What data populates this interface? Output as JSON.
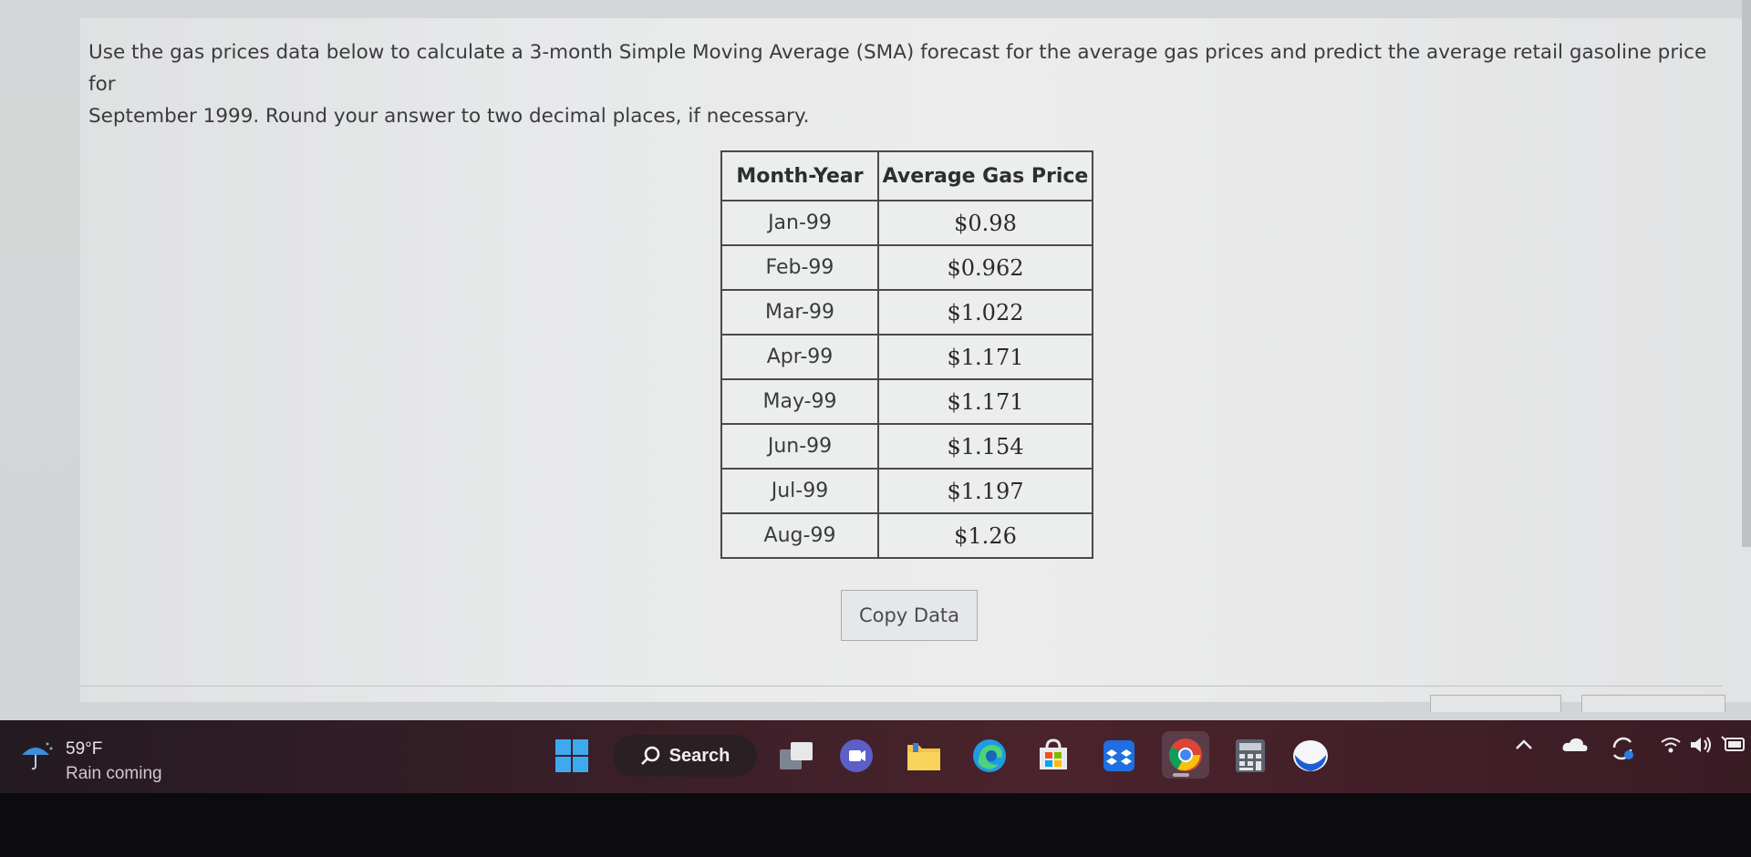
{
  "question": {
    "line1": "Use the gas prices data below to calculate a 3-month Simple Moving Average (SMA) forecast for the average gas prices and predict the average retail gasoline price for",
    "line2": "September 1999. Round your answer to two decimal places, if necessary."
  },
  "table": {
    "headers": [
      "Month-Year",
      "Average Gas Price"
    ],
    "rows": [
      {
        "month": "Jan-99",
        "price": "$0.98"
      },
      {
        "month": "Feb-99",
        "price": "$0.962"
      },
      {
        "month": "Mar-99",
        "price": "$1.022"
      },
      {
        "month": "Apr-99",
        "price": "$1.171"
      },
      {
        "month": "May-99",
        "price": "$1.171"
      },
      {
        "month": "Jun-99",
        "price": "$1.154"
      },
      {
        "month": "Jul-99",
        "price": "$1.197"
      },
      {
        "month": "Aug-99",
        "price": "$1.26"
      }
    ]
  },
  "copy_button": "Copy Data",
  "taskbar": {
    "weather_temp": "59°F",
    "weather_desc": "Rain coming",
    "search_label": "Search",
    "icons": [
      "windows-start-icon",
      "search-icon",
      "task-view-icon",
      "teams-chat-icon",
      "file-explorer-icon",
      "edge-icon",
      "microsoft-store-icon",
      "dropbox-icon",
      "chrome-icon",
      "calculator-icon",
      "blue-app-icon"
    ],
    "tray_icons": [
      "chevron-up-icon",
      "onedrive-icon",
      "sync-icon",
      "wifi-icon",
      "volume-icon",
      "battery-icon"
    ]
  },
  "colors": {
    "page_bg": "#e6e7e8",
    "text": "#3a3b3d",
    "table_border": "#4a4a4a",
    "taskbar_bg": "#3a1f28"
  }
}
